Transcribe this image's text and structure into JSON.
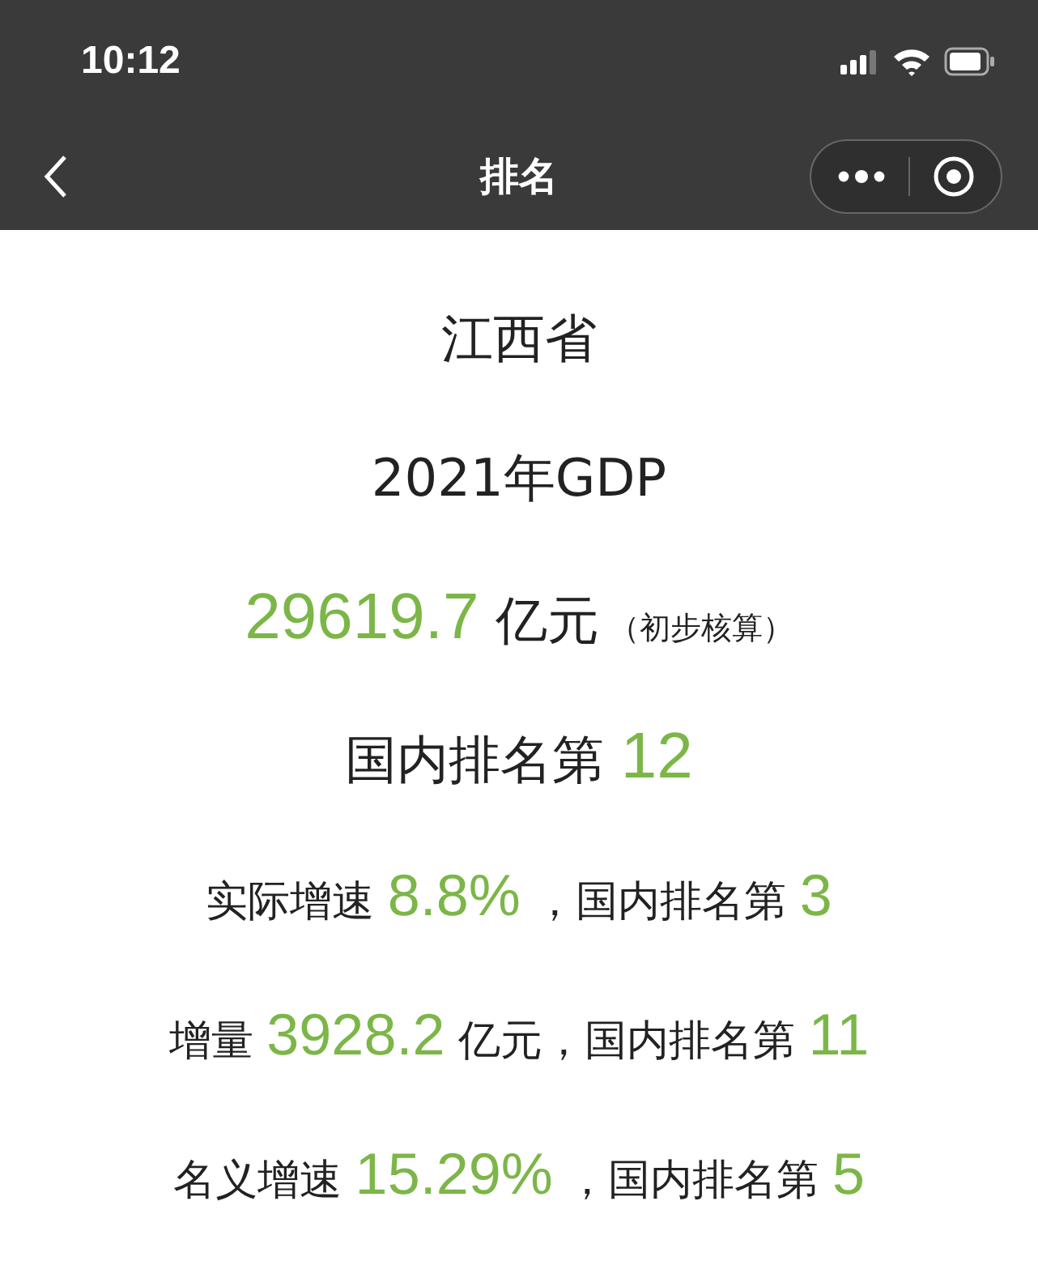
{
  "status_bar": {
    "time": "10:12"
  },
  "nav_bar": {
    "title": "排名"
  },
  "lines": [
    {
      "kind": "title",
      "segments": [
        {
          "kind": "text",
          "text": "江西省"
        }
      ]
    },
    {
      "kind": "title",
      "segments": [
        {
          "kind": "text",
          "text": "2021年GDP"
        }
      ]
    },
    {
      "kind": "title",
      "segments": [
        {
          "kind": "number",
          "text": "29619.7"
        },
        {
          "kind": "text",
          "text": " 亿元"
        },
        {
          "kind": "note",
          "text": "（初步核算）"
        }
      ]
    },
    {
      "kind": "title",
      "segments": [
        {
          "kind": "text",
          "text": "国内排名第 "
        },
        {
          "kind": "number",
          "text": "12"
        }
      ]
    },
    {
      "kind": "stat",
      "segments": [
        {
          "kind": "text",
          "text": "实际增速 "
        },
        {
          "kind": "number",
          "text": "8.8%"
        },
        {
          "kind": "text",
          "text": " ，国内排名第 "
        },
        {
          "kind": "number",
          "text": "3"
        }
      ]
    },
    {
      "kind": "stat",
      "segments": [
        {
          "kind": "text",
          "text": "增量 "
        },
        {
          "kind": "number",
          "text": "3928.2"
        },
        {
          "kind": "text",
          "text": " 亿元，国内排名第 "
        },
        {
          "kind": "number",
          "text": "11"
        }
      ]
    },
    {
      "kind": "stat",
      "segments": [
        {
          "kind": "text",
          "text": "名义增速 "
        },
        {
          "kind": "number",
          "text": "15.29%"
        },
        {
          "kind": "text",
          "text": " ，国内排名第 "
        },
        {
          "kind": "number",
          "text": "5"
        }
      ]
    }
  ]
}
